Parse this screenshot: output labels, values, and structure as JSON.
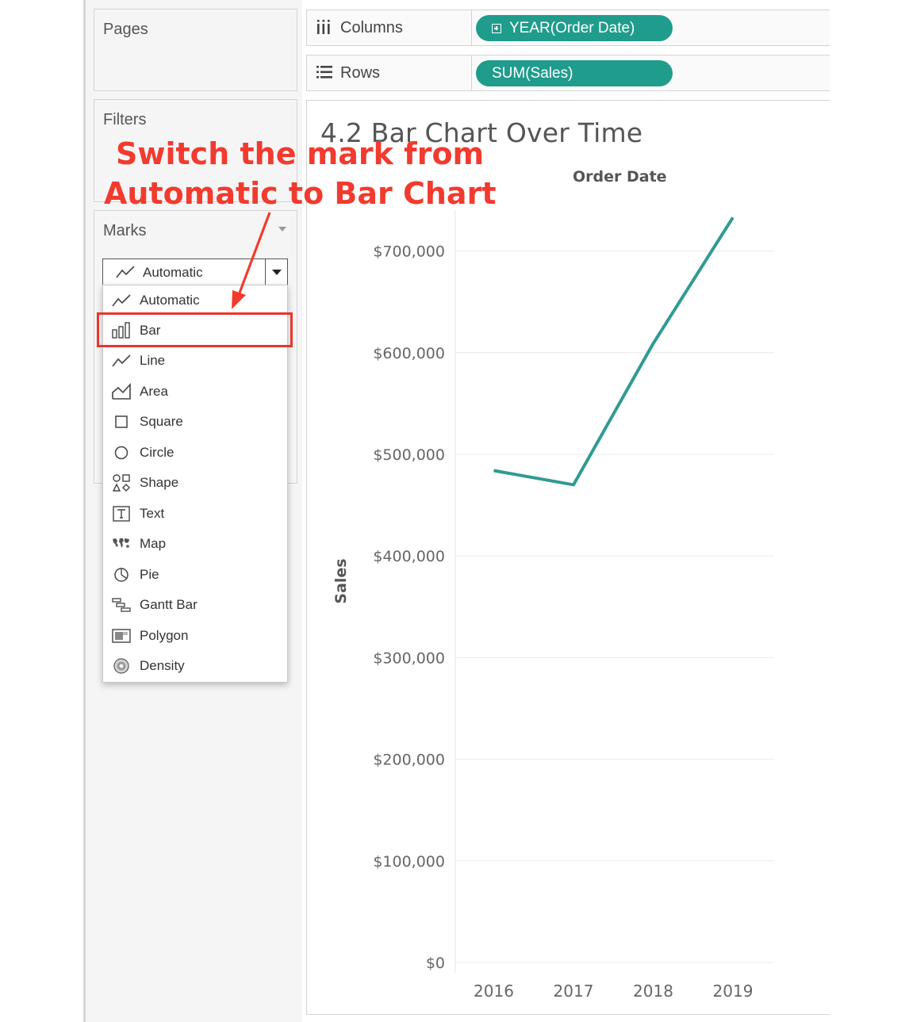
{
  "pages": {
    "title": "Pages"
  },
  "filters": {
    "title": "Filters"
  },
  "marks": {
    "title": "Marks",
    "selected": "Automatic",
    "options": [
      {
        "label": "Automatic",
        "icon": "automatic-line-icon"
      },
      {
        "label": "Bar",
        "icon": "bar-icon"
      },
      {
        "label": "Line",
        "icon": "line-icon"
      },
      {
        "label": "Area",
        "icon": "area-icon"
      },
      {
        "label": "Square",
        "icon": "square-icon"
      },
      {
        "label": "Circle",
        "icon": "circle-icon"
      },
      {
        "label": "Shape",
        "icon": "shape-icon"
      },
      {
        "label": "Text",
        "icon": "text-icon"
      },
      {
        "label": "Map",
        "icon": "map-icon"
      },
      {
        "label": "Pie",
        "icon": "pie-icon"
      },
      {
        "label": "Gantt Bar",
        "icon": "gantt-bar-icon"
      },
      {
        "label": "Polygon",
        "icon": "polygon-icon"
      },
      {
        "label": "Density",
        "icon": "density-icon"
      }
    ],
    "highlighted": "Bar"
  },
  "shelves": {
    "columns": {
      "label": "Columns",
      "pill": "YEAR(Order Date)"
    },
    "rows": {
      "label": "Rows",
      "pill": "SUM(Sales)"
    }
  },
  "annotation": {
    "line1": "Switch the mark from",
    "line2": "Automatic to Bar Chart"
  },
  "colors": {
    "accent": "#1f9c8c",
    "annotation": "#f23a2e",
    "line": "#2f9b93"
  },
  "chart_data": {
    "type": "line",
    "title": "4.2 Bar Chart Over Time",
    "column_header": "Order Date",
    "ylabel": "Sales",
    "x": [
      "2016",
      "2017",
      "2018",
      "2019"
    ],
    "series": [
      {
        "values": [
          484000,
          470000,
          609000,
          733000
        ]
      }
    ],
    "y_ticks": [
      0,
      100000,
      200000,
      300000,
      400000,
      500000,
      600000,
      700000
    ],
    "y_tick_labels": [
      "$0",
      "$100,000",
      "$200,000",
      "$300,000",
      "$400,000",
      "$500,000",
      "$600,000",
      "$700,000"
    ],
    "ylim": [
      0,
      750000
    ],
    "grid": true
  }
}
